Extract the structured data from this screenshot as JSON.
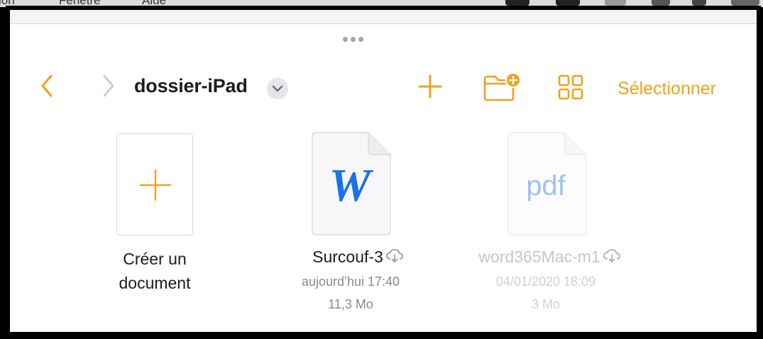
{
  "menubar": {
    "items": [
      "ion",
      "Fenêtre",
      "Aide"
    ]
  },
  "toolbar": {
    "folder_title": "dossier-iPad",
    "select_label": "Sélectionner",
    "accent": "#f0a11c"
  },
  "create_tile": {
    "label_line1": "Créer un",
    "label_line2": "document"
  },
  "files": [
    {
      "name": "Surcouf-3",
      "date": "aujourd’hui 17:40",
      "size": "11,3 Mo",
      "type_icon": "word-doc-icon",
      "glyph": "W",
      "glyph_color": "#1a73e8",
      "dimmed": false
    },
    {
      "name": "word365Mac-m1",
      "date": "04/01/2020 18:09",
      "size": "3 Mo",
      "type_icon": "pdf-doc-icon",
      "glyph": "pdf",
      "glyph_color": "#9ec3f0",
      "dimmed": true
    }
  ]
}
